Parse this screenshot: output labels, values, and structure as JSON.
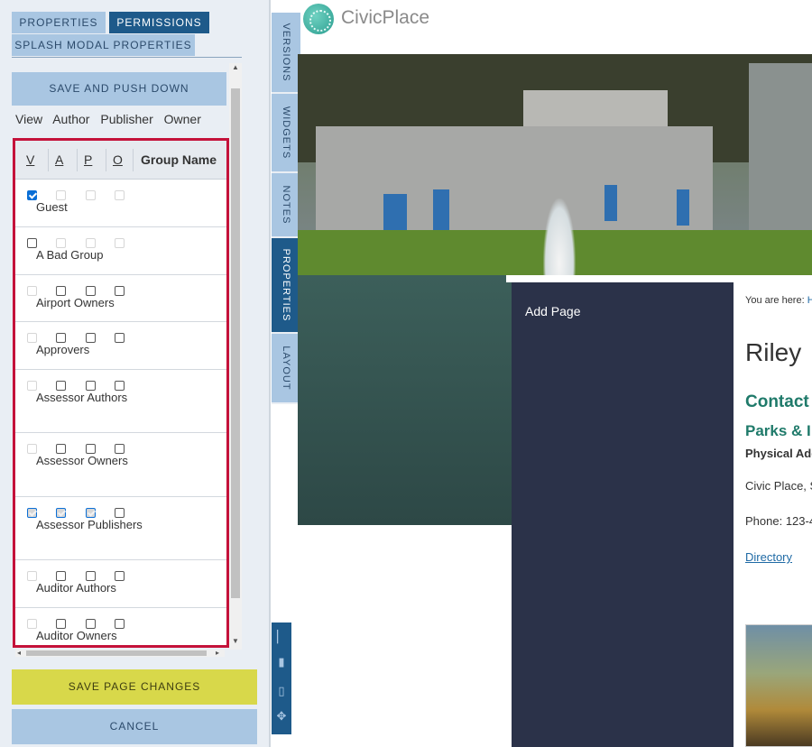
{
  "tabs": {
    "properties": "Properties",
    "permissions": "Permissions",
    "splash": "Splash Modal Properties"
  },
  "panel": {
    "save_push_label": "Save and Push Down",
    "legend": {
      "v": "View",
      "a": "Author",
      "p": "Publisher",
      "o": "Owner"
    },
    "headers": {
      "v": "V",
      "a": "A",
      "p": "P",
      "o": "O",
      "group": "Group Name"
    },
    "rows": [
      {
        "name": "Guest",
        "v": true,
        "a": false,
        "p": false,
        "o": false,
        "enabled": [
          true,
          false,
          false,
          false
        ]
      },
      {
        "name": "A Bad Group",
        "v": false,
        "a": false,
        "p": false,
        "o": false,
        "enabled": [
          true,
          false,
          false,
          false
        ]
      },
      {
        "name": "Airport Owners",
        "v": false,
        "a": false,
        "p": false,
        "o": false,
        "enabled": [
          false,
          true,
          true,
          true
        ]
      },
      {
        "name": "Approvers",
        "v": false,
        "a": false,
        "p": false,
        "o": false,
        "enabled": [
          false,
          true,
          true,
          true
        ]
      },
      {
        "name": "Assessor Authors",
        "v": false,
        "a": false,
        "p": false,
        "o": false,
        "enabled": [
          false,
          true,
          true,
          true
        ]
      },
      {
        "name": "Assessor Owners",
        "v": false,
        "a": false,
        "p": false,
        "o": false,
        "enabled": [
          false,
          true,
          true,
          true
        ]
      },
      {
        "name": "Assessor Publishers",
        "v": true,
        "a": true,
        "p": true,
        "o": false,
        "enabled": [
          false,
          false,
          false,
          true
        ]
      },
      {
        "name": "Auditor Authors",
        "v": false,
        "a": false,
        "p": false,
        "o": false,
        "enabled": [
          false,
          true,
          true,
          true
        ]
      },
      {
        "name": "Auditor Owners",
        "v": false,
        "a": false,
        "p": false,
        "o": false,
        "enabled": [
          false,
          true,
          true,
          true
        ]
      }
    ],
    "save_page_label": "Save Page Changes",
    "cancel_label": "Cancel"
  },
  "side_tabs": [
    "Versions",
    "Widgets",
    "Notes",
    "Properties",
    "Layout"
  ],
  "site": {
    "brand": "CivicPlace",
    "add_page_label": "Add Page",
    "breadcrumb_prefix": "You are here:",
    "breadcrumb_link": "H",
    "page_title": "Riley",
    "contact_heading": "Contact",
    "dept_name": "Parks & I",
    "address_label": "Physical Add",
    "address_text": "Civic Place, S",
    "phone_text": "Phone: 123-4",
    "directory_link": "Directory"
  },
  "colors": {
    "accent": "#1e5a8a",
    "tab_bg": "#a9c6e2",
    "highlight_border": "#c4123a",
    "save_button": "#d8d84a",
    "panel_dark": "#2b3249",
    "teal": "#1f7a6a"
  }
}
